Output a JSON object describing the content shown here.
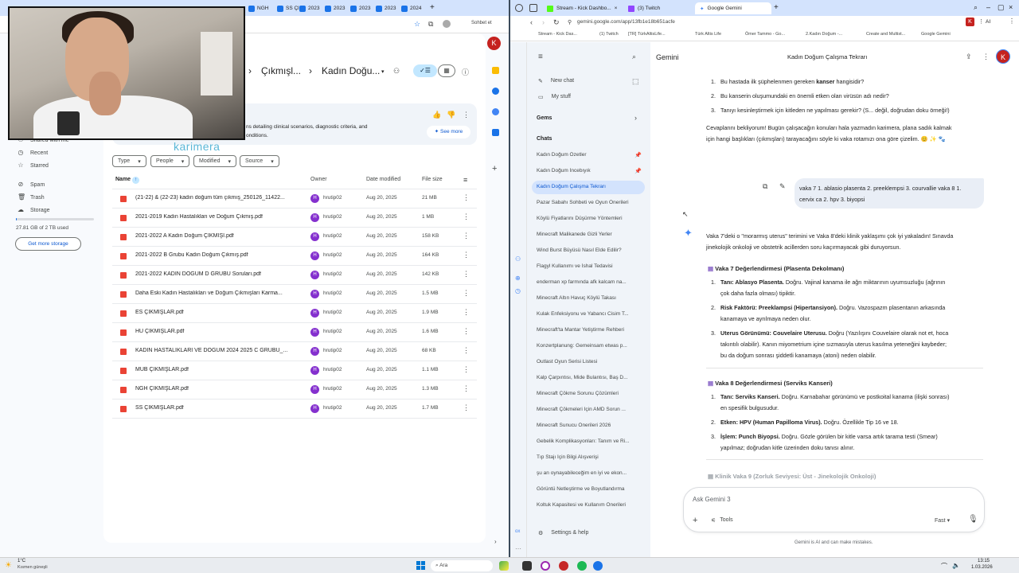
{
  "drive": {
    "tabs": [
      "NGH",
      "SS Çl",
      "2023",
      "2023",
      "2023",
      "2023",
      "2024"
    ],
    "toolbar_profile": "Sohbet et",
    "sidebar": {
      "items": [
        {
          "label": "Shared with me",
          "icon": "people-icon"
        },
        {
          "label": "Recent",
          "icon": "clock-icon"
        },
        {
          "label": "Starred",
          "icon": "star-icon"
        },
        {
          "label": "Spam",
          "icon": "spam-icon"
        },
        {
          "label": "Trash",
          "icon": "trash-icon"
        },
        {
          "label": "Storage",
          "icon": "cloud-icon"
        }
      ],
      "storage_text": "27.81 GB of 2 TB used",
      "storage_fraction": 0.014,
      "get_more_storage": "Get more storage"
    },
    "breadcrumb": {
      "parent": "Çıkmışl...",
      "current": "Kadın Doğu..."
    },
    "ai_summary": {
      "line1": "ns detailing clinical scenarios, diagnostic criteria, and",
      "line2": "onditions.",
      "see_more": "See more"
    },
    "watermark": "karimera",
    "filters": [
      "Type",
      "People",
      "Modified",
      "Source"
    ],
    "columns": {
      "name": "Name",
      "owner": "Owner",
      "date": "Date modified",
      "size": "File size"
    },
    "files": [
      {
        "name": "(21-22) & (22-23) kadın doğum tüm çıkmış_250126_11422...",
        "owner": "hrutip02",
        "date": "Aug 20, 2025",
        "size": "21 MB"
      },
      {
        "name": "2021-2019 Kadın Hastalıkları ve Doğum Çıkmış.pdf",
        "owner": "hrutip02",
        "date": "Aug 20, 2025",
        "size": "1 MB"
      },
      {
        "name": "2021-2022 A Kadın Doğum ÇIKMIŞI.pdf",
        "owner": "hrutip02",
        "date": "Aug 20, 2025",
        "size": "158 KB"
      },
      {
        "name": "2021-2022 B Grubu Kadın Doğum Çıkmış.pdf",
        "owner": "hrutip02",
        "date": "Aug 20, 2025",
        "size": "164 KB"
      },
      {
        "name": "2021-2022 KADIN DOĞUM D GRUBU Soruları.pdf",
        "owner": "hrutip02",
        "date": "Aug 20, 2025",
        "size": "142 KB"
      },
      {
        "name": "Daha Eski Kadın Hastalıkları ve Doğum Çıkmışları Karma...",
        "owner": "hrutip02",
        "date": "Aug 20, 2025",
        "size": "1.5 MB"
      },
      {
        "name": "ES ÇIKMIŞLAR.pdf",
        "owner": "hrutip02",
        "date": "Aug 20, 2025",
        "size": "1.9 MB"
      },
      {
        "name": "HU ÇIKMIŞLAR.pdf",
        "owner": "hrutip02",
        "date": "Aug 20, 2025",
        "size": "1.6 MB"
      },
      {
        "name": "KADIN HASTALIKLARI VE DOĞUM 2024 2025 C GRUBU_...",
        "owner": "hrutip02",
        "date": "Aug 20, 2025",
        "size": "68 KB"
      },
      {
        "name": "MUB ÇIKMIŞLAR.pdf",
        "owner": "hrutip02",
        "date": "Aug 20, 2025",
        "size": "1.1 MB"
      },
      {
        "name": "NGH ÇIKMIŞLAR.pdf",
        "owner": "hrutip02",
        "date": "Aug 20, 2025",
        "size": "1.3 MB"
      },
      {
        "name": "SS ÇIKMIŞLAR.pdf",
        "owner": "hrutip02",
        "date": "Aug 20, 2025",
        "size": "1.7 MB"
      }
    ],
    "avatar_letter": "K",
    "owner_letter": "H"
  },
  "gemini": {
    "tabs": [
      {
        "label": "Stream - Kick Dashbo..."
      },
      {
        "label": "(3) Twitch"
      },
      {
        "label": "Google Gemini"
      }
    ],
    "url": "gemini.google.com/app/13fb1e18b651acfe",
    "ai_label": "AI",
    "bookmarks": [
      "Stream - Kick Das...",
      "(1) Twitch",
      "[TR] TürkAltisLife...",
      "Türk Altis Life",
      "Ömer Tammo - Go...",
      "2.Kadın Doğum -...",
      "Create and Multist...",
      "Google Gemini"
    ],
    "sidebar": {
      "new_chat": "New chat",
      "my_stuff": "My stuff",
      "gems": "Gems",
      "chats": "Chats",
      "chat_items": [
        "Kadın Doğum Özetler",
        "Kadın Doğum İncebıyık",
        "Kadın Doğum Çalışma Tekrarı",
        "Pazar Sabahı Sohbeti ve Oyun Önerileri",
        "Köylü Fiyatlarını Düşürme Yöntemleri",
        "Minecraft Malikanede Gizli Yerler",
        "Wind Burst Büyüsü Nasıl Elde Edilir?",
        "Flagyl Kullanımı ve İshal Tedavisi",
        "enderman xp farmında afk kalcam na...",
        "Minecraft Altın Havuç Köylü Takası",
        "Kulak Enfeksiyonu ve Yabancı Cisim T...",
        "Minecraft'ta Mantar Yetiştirme Rehberi",
        "Konzertplanung: Gemeinsam etwas p...",
        "Outlast Oyun Serisi Listesi",
        "Kalp Çarpıntısı, Mide Bulantısı, Baş D...",
        "Minecraft Çökme Sorunu Çözümleri",
        "Minecraft Çökmeleri İçin AMD Sorun ...",
        "Minecraft Sunucu Önerileri 2026",
        "Gebelik Komplikasyonları: Tanım ve Ri...",
        "Tıp Stajı İçin Bilgi Alışverişi",
        "şu an oynayabileceğim en iyi ve ekon...",
        "Görüntü Netleştirme ve Boyutlandırma",
        "Koltuk Kapasitesi ve Kullanım Önerileri"
      ],
      "settings": "Settings & help"
    },
    "header": {
      "brand": "Gemini",
      "title": "Kadın Doğum Çalışma Tekrarı",
      "avatar": "K"
    },
    "prev_list": [
      {
        "n": "1.",
        "pre": "Bu hastada ilk şüphelenmen gereken ",
        "bold": "kanser",
        "post": " hangisidir?"
      },
      {
        "n": "2.",
        "pre": "Bu kanserin oluşumundaki en önemli etken olan virüsün adı nedir?",
        "bold": "",
        "post": ""
      },
      {
        "n": "3.",
        "pre": "Tanıyı kesinleştirmek için kitleden ne yapılması gerekir? (S... değil, doğrudan doku örneği!)",
        "bold": "",
        "post": ""
      }
    ],
    "prev_para": "Cevaplarını bekliyorum! Bugün çalışacağın konuları hala yazmadın karimera, plana sadık kalmak",
    "prev_para2": "için hangi başlıkları (çıkmışları) tarayacağını söyle ki vaka rotamızı ona göre çizelim. 😊 ✨ 🐾",
    "user_msg_1": "vaka 7 1. ablasio plasenta 2. preeklempsi 3. courvallie vaka 8 1.",
    "user_msg_2": "cervix ca 2. hpv 3. biyopsi",
    "reply_intro_1": "Vaka 7'deki o \"morarmış uterus\" terimini ve Vaka 8'deki klinik yaklaşımı çok iyi yakaladın! Sınavda",
    "reply_intro_2": "jinekolojik onkoloji ve obstetrik acillerden soru kaçırmayacak gibi duruyorsun.",
    "vaka7": {
      "heading": "Vaka 7 Değerlendirmesi (Plasenta Dekolmanı)",
      "items": [
        {
          "n": "1.",
          "label": "Tanı: Ablasyo Plasenta.",
          "l1": " Doğru. Vajinal kanama ile ağrı miktarının uyumsuzluğu (ağrının",
          "l2": "çok daha fazla olması) tipiktir."
        },
        {
          "n": "2.",
          "label": "Risk Faktörü: Preeklampsi (Hipertansiyon).",
          "l1": " Doğru. Vazospazm plasentanın arkasında",
          "l2": "kanamaya ve ayrılmaya neden olur."
        },
        {
          "n": "3.",
          "label": "Uterus Görünümü: Couvelaire Uterusu.",
          "l1": " Doğru (Yazılışını Couvelaire olarak not et, hoca",
          "l2": "takıntılı olabilir). Kanın miyometrium içine sızmasıyla uterus kasılma yeteneğini kaybeder;",
          "l3": "bu da doğum sonrası şiddetli kanamaya (atoni) neden olabilir."
        }
      ]
    },
    "vaka8": {
      "heading": "Vaka 8 Değerlendirmesi (Serviks Kanseri)",
      "items": [
        {
          "n": "1.",
          "label": "Tanı: Serviks Kanseri.",
          "l1": " Doğru. Karnabahar görünümü ve postkoital kanama (ilişki sonrası)",
          "l2": "en spesifik bulgusudur."
        },
        {
          "n": "2.",
          "label": "Etken: HPV (Human Papilloma Virus).",
          "l1": " Doğru. Özellikle Tip 16 ve 18.",
          "l2": ""
        },
        {
          "n": "3.",
          "label": "İşlem: Punch Biyopsi.",
          "l1": " Doğru. Gözle görülen bir kitle varsa artık tarama testi (Smear)",
          "l2": "yapılmaz; doğrudan kitle üzerinden doku tanısı alınır."
        }
      ]
    },
    "next_heading": "Klinik Vaka 9 (Zorluk Seviyesi: Üst - Jinekolojik Onkoloji)",
    "input": {
      "placeholder": "Ask Gemini 3",
      "tools": "Tools",
      "mode": "Fast"
    },
    "disclaimer": "Gemini is AI and can make mistakes."
  },
  "taskbar": {
    "weather_temp": "1°C",
    "weather_desc": "Kısmen güneşli",
    "search": "Ara",
    "time": "13:15",
    "date": "1.03.2026"
  }
}
